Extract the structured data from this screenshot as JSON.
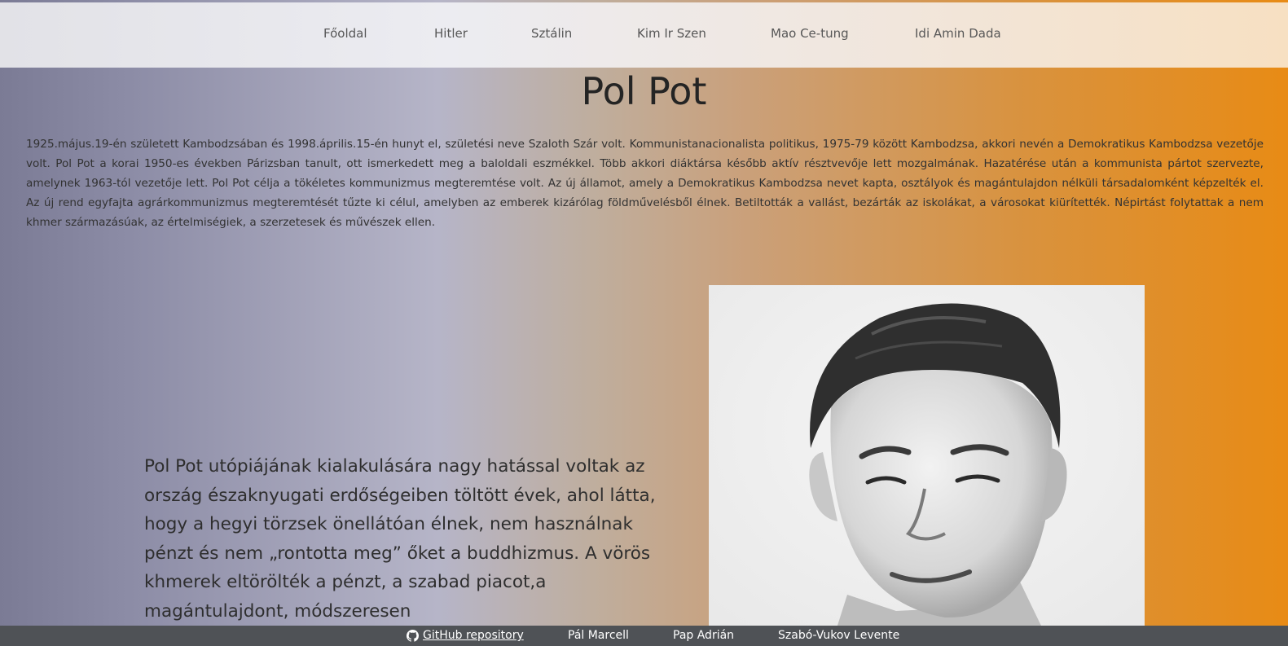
{
  "nav": {
    "items": [
      {
        "label": "Főoldal"
      },
      {
        "label": "Hitler"
      },
      {
        "label": "Sztálin"
      },
      {
        "label": "Kim Ir Szen"
      },
      {
        "label": "Mao Ce-tung"
      },
      {
        "label": "Idi Amin Dada"
      }
    ]
  },
  "main": {
    "title": "Pol Pot",
    "intro": "1925.május.19-én született Kambodzsában és 1998.április.15-én hunyt el, születési neve Szaloth Szár volt. Kommunistanacionalista politikus, 1975-79 között Kambodzsa, akkori nevén a Demokratikus Kambodzsa vezetője volt. Pol Pot a korai 1950-es években Párizsban tanult, ott ismerkedett meg a baloldali eszmékkel. Több akkori diáktársa később aktív résztvevője lett mozgalmának. Hazatérése után a kommunista pártot szervezte, amelynek 1963-tól vezetője lett. Pol Pot célja a tökéletes kommunizmus megteremtése volt. Az új államot, amely a Demokratikus Kambodzsa nevet kapta, osztályok és magántulajdon nélküli társadalomként képzelték el. Az új rend egyfajta agrárkommunizmus megteremtését tűzte ki célul, amelyben az emberek kizárólag földművelésből élnek. Betiltották a vallást, bezárták az iskolákat, a városokat kiürítették. Népirtást folytattak a nem khmer származásúak, az értelmiségiek, a szerzetesek és művészek ellen.",
    "quote": "Pol Pot utópiájának kialakulására nagy hatással voltak az ország északnyugati erdőségeiben töltött évek, ahol látta, hogy a hegyi törzsek önellátóan élnek, nem használnak pénzt és nem „rontotta meg” őket a buddhizmus. A vörös khmerek eltörölték a pénzt, a szabad piacot,a magántulajdont, módszeresen",
    "portrait_icon": "portrait-photo"
  },
  "footer": {
    "repo_label": "GitHub repository",
    "repo_icon": "github-icon",
    "authors": [
      "Pál Marcell",
      "Pap Adrián",
      "Szabó-Vukov Levente"
    ]
  }
}
